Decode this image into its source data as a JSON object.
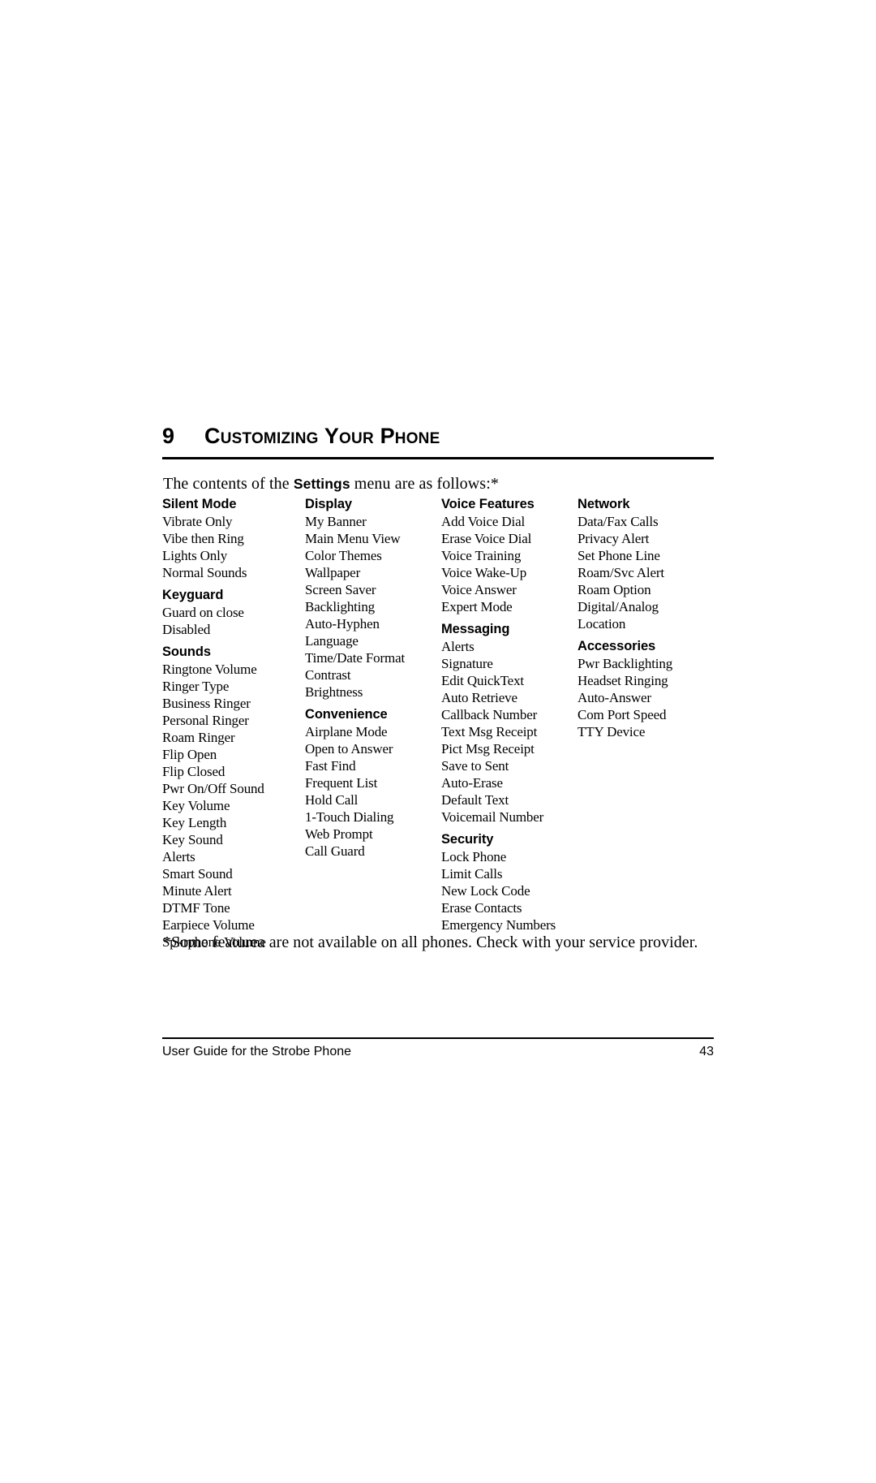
{
  "chapter": {
    "number": "9",
    "title": "Customizing Your Phone"
  },
  "intro": {
    "before": "The contents of the ",
    "bold": "Settings",
    "after": " menu are as follows:*"
  },
  "columns": [
    {
      "groups": [
        {
          "title": "Silent Mode",
          "items": [
            "Vibrate Only",
            "Vibe then Ring",
            "Lights Only",
            "Normal Sounds"
          ]
        },
        {
          "title": "Keyguard",
          "items": [
            "Guard on close",
            "Disabled"
          ]
        },
        {
          "title": "Sounds",
          "items": [
            "Ringtone Volume",
            "Ringer Type",
            "Business Ringer",
            "Personal Ringer",
            "Roam Ringer",
            "Flip Open",
            "Flip Closed",
            "Pwr On/Off Sound",
            "Key Volume",
            "Key Length",
            "Key Sound",
            "Alerts",
            "Smart Sound",
            "Minute Alert",
            "DTMF Tone",
            "Earpiece Volume",
            "Spkrphone Volume"
          ]
        }
      ]
    },
    {
      "groups": [
        {
          "title": "Display",
          "items": [
            "My Banner",
            "Main Menu View",
            "Color Themes",
            "Wallpaper",
            "Screen Saver",
            "Backlighting",
            "Auto-Hyphen",
            "Language",
            "Time/Date Format",
            "Contrast",
            "Brightness"
          ]
        },
        {
          "title": "Convenience",
          "items": [
            "Airplane Mode",
            "Open to Answer",
            "Fast Find",
            "Frequent List",
            "Hold Call",
            "1-Touch Dialing",
            "Web Prompt",
            "Call Guard"
          ]
        }
      ]
    },
    {
      "groups": [
        {
          "title": "Voice Features",
          "items": [
            "Add Voice Dial",
            "Erase Voice Dial",
            "Voice Training",
            "Voice Wake-Up",
            "Voice Answer",
            "Expert Mode"
          ]
        },
        {
          "title": "Messaging",
          "items": [
            "Alerts",
            "Signature",
            "Edit QuickText",
            "Auto Retrieve",
            "Callback Number",
            "Text Msg Receipt",
            "Pict Msg Receipt",
            "Save to Sent",
            "Auto-Erase",
            "Default Text",
            "Voicemail Number"
          ]
        },
        {
          "title": "Security",
          "items": [
            "Lock Phone",
            "Limit Calls",
            "New Lock Code",
            "Erase Contacts",
            "Emergency Numbers"
          ]
        }
      ]
    },
    {
      "groups": [
        {
          "title": "Network",
          "items": [
            "Data/Fax Calls",
            "Privacy Alert",
            "Set Phone Line",
            "Roam/Svc Alert",
            "Roam Option",
            "Digital/Analog",
            "Location"
          ]
        },
        {
          "title": "Accessories",
          "items": [
            "Pwr Backlighting",
            "Headset Ringing",
            "Auto-Answer",
            "Com Port Speed",
            "TTY Device"
          ]
        }
      ]
    }
  ],
  "footnote": "*Some featurea are not available on all phones. Check with your service provider.",
  "footer": {
    "document_title": "User Guide for the Strobe Phone",
    "page_number": "43"
  }
}
